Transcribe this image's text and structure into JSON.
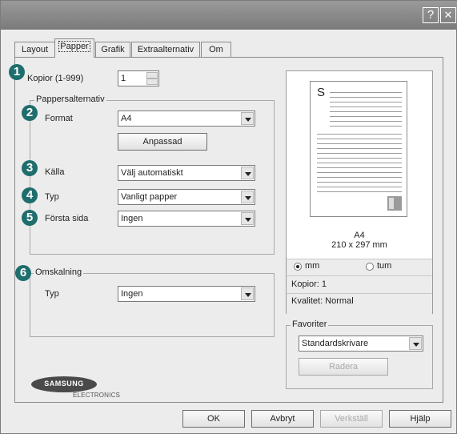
{
  "window": {
    "help_btn": "?",
    "close_btn": "✕"
  },
  "tabs": [
    {
      "label": "Layout"
    },
    {
      "label": "Papper"
    },
    {
      "label": "Grafik"
    },
    {
      "label": "Extraalternativ"
    },
    {
      "label": "Om"
    }
  ],
  "copies": {
    "badge": "1",
    "label": "Kopior (1-999)",
    "value": "1"
  },
  "paper_options": {
    "legend": "Pappersalternativ",
    "format": {
      "badge": "2",
      "label": "Format",
      "value": "A4",
      "custom_button": "Anpassad"
    },
    "source": {
      "badge": "3",
      "label": "Källa",
      "value": "Välj automatiskt"
    },
    "type": {
      "badge": "4",
      "label": "Typ",
      "value": "Vanligt papper"
    },
    "first_page": {
      "badge": "5",
      "label": "Första sida",
      "value": "Ingen"
    }
  },
  "scaling": {
    "badge": "6",
    "legend": "Omskalning",
    "type_label": "Typ",
    "type_value": "Ingen"
  },
  "preview": {
    "page_letter": "S",
    "size_name": "A4",
    "size_dims": "210 x 297 mm",
    "unit_mm": "mm",
    "unit_inch": "tum",
    "selected_unit": "mm",
    "copies": "Kopior: 1",
    "quality": "Kvalitet: Normal"
  },
  "favorites": {
    "legend": "Favoriter",
    "value": "Standardskrivare",
    "delete_button": "Radera"
  },
  "logo": {
    "brand": "SAMSUNG",
    "sub": "ELECTRONICS"
  },
  "footer": {
    "ok": "OK",
    "cancel": "Avbryt",
    "apply": "Verkställ",
    "help": "Hjälp"
  }
}
